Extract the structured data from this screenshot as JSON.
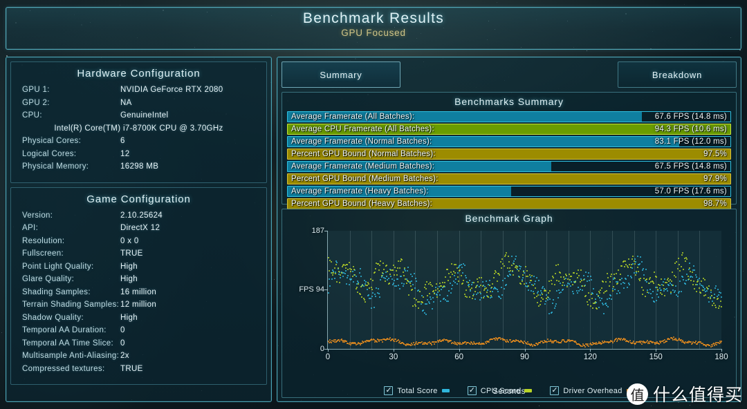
{
  "header": {
    "title": "Benchmark Results",
    "subtitle": "GPU Focused"
  },
  "hardware": {
    "section_title": "Hardware Configuration",
    "rows": [
      {
        "key": "GPU 1:",
        "value": "NVIDIA GeForce RTX 2080"
      },
      {
        "key": "GPU 2:",
        "value": "NA"
      },
      {
        "key": "CPU:",
        "value": "GenuineIntel"
      },
      {
        "key": "",
        "value": "Intel(R) Core(TM) i7-8700K CPU @ 3.70GHz"
      },
      {
        "key": "Physical Cores:",
        "value": "6"
      },
      {
        "key": "Logical Cores:",
        "value": "12"
      },
      {
        "key": "Physical Memory:",
        "value": "16298  MB"
      }
    ]
  },
  "game": {
    "section_title": "Game Configuration",
    "rows": [
      {
        "key": "Version:",
        "value": "2.10.25624"
      },
      {
        "key": "API:",
        "value": "DirectX 12"
      },
      {
        "key": "Resolution:",
        "value": "0 x 0"
      },
      {
        "key": "Fullscreen:",
        "value": "TRUE"
      },
      {
        "key": "Point Light Quality:",
        "value": "High"
      },
      {
        "key": "Glare Quality:",
        "value": "High"
      },
      {
        "key": "Shading Samples:",
        "value": "16 million"
      },
      {
        "key": "Terrain Shading Samples:",
        "value": "12 million"
      },
      {
        "key": "Shadow Quality:",
        "value": "High"
      },
      {
        "key": "Temporal AA Duration:",
        "value": "0"
      },
      {
        "key": "Temporal AA Time Slice:",
        "value": "0"
      },
      {
        "key": "Multisample Anti-Aliasing:",
        "value": "2x"
      },
      {
        "key": "Compressed textures:",
        "value": "TRUE"
      }
    ]
  },
  "tabs": [
    {
      "label": "Summary",
      "active": true
    },
    {
      "label": "Breakdown",
      "active": false
    }
  ],
  "summary": {
    "title": "Benchmarks Summary",
    "bars": [
      {
        "label": "Average Framerate (All Batches):",
        "value": "67.6 FPS (14.8 ms)",
        "fill_pct": 80.0,
        "style": "teal"
      },
      {
        "label": "Average CPU Framerate (All Batches):",
        "value": "94.3 FPS (10.6 ms)",
        "fill_pct": 100.0,
        "style": "green"
      },
      {
        "label": "Average Framerate (Normal Batches):",
        "value": "83.1 FPS (12.0 ms)",
        "fill_pct": 88.5,
        "style": "teal"
      },
      {
        "label": "Percent GPU Bound (Normal Batches):",
        "value": "97.5%",
        "fill_pct": 100.0,
        "style": "gold"
      },
      {
        "label": "Average Framerate (Medium Batches):",
        "value": "67.5 FPS (14.8 ms)",
        "fill_pct": 59.5,
        "style": "teal"
      },
      {
        "label": "Percent GPU Bound (Medium Batches):",
        "value": "97.9%",
        "fill_pct": 100.0,
        "style": "gold"
      },
      {
        "label": "Average Framerate (Heavy Batches):",
        "value": "57.0 FPS (17.6 ms)",
        "fill_pct": 50.5,
        "style": "teal"
      },
      {
        "label": "Percent GPU Bound (Heavy Batches):",
        "value": "98.7%",
        "fill_pct": 100.0,
        "style": "gold"
      }
    ]
  },
  "graph": {
    "title": "Benchmark Graph"
  },
  "chart_data": {
    "type": "scatter",
    "title": "Benchmark Graph",
    "xlabel": "Seconds",
    "ylabel": "FPS",
    "xlim": [
      0,
      180
    ],
    "ylim": [
      0,
      187
    ],
    "xticks": [
      0,
      30,
      60,
      90,
      120,
      150,
      180
    ],
    "yticks": [
      0,
      94,
      187
    ],
    "ytick_labels": [
      "0",
      "FPS 94",
      "187"
    ],
    "grid": "vertical",
    "legend_position": "bottom",
    "series": [
      {
        "name": "Total Score",
        "color": "#2fb6dc",
        "checked": true,
        "mean_y": 100,
        "spread_y": 38
      },
      {
        "name": "CPU Score",
        "color": "#b8d426",
        "checked": true,
        "mean_y": 108,
        "spread_y": 40
      },
      {
        "name": "Driver Overhead",
        "color": "#e58b1e",
        "checked": true,
        "mean_y": 12,
        "spread_y": 6
      }
    ]
  },
  "legend": [
    {
      "label": "Total Score",
      "color": "#2fb6dc",
      "checked": true
    },
    {
      "label": "CPU Score",
      "color": "#b8d426",
      "checked": true
    },
    {
      "label": "Driver Overhead",
      "color": "#e58b1e",
      "checked": true
    }
  ],
  "watermark": {
    "glyph": "值",
    "text": "什么值得买"
  }
}
